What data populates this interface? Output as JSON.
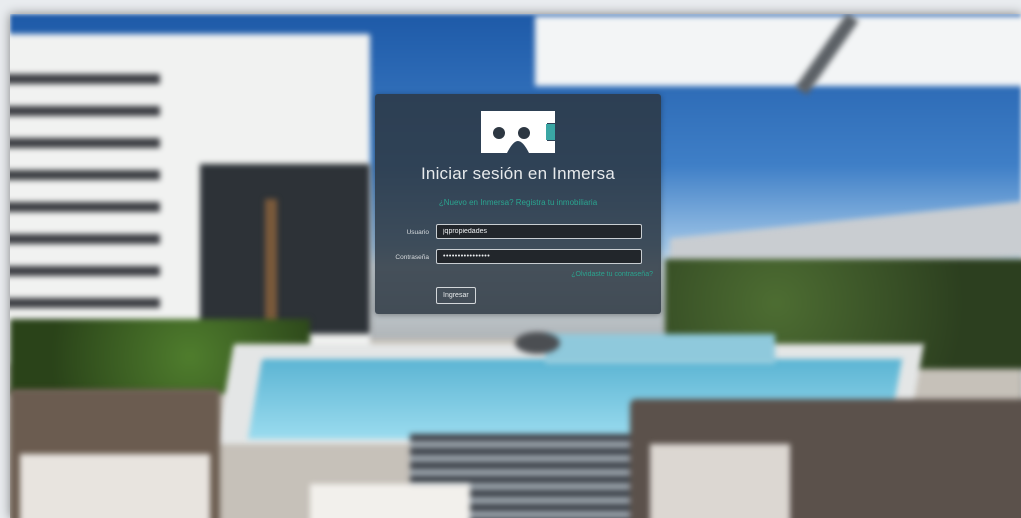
{
  "login": {
    "title": "Iniciar sesión en Inmersa",
    "register_link": "¿Nuevo en Inmersa? Registra tu inmobiliaria",
    "username_label": "Usuario",
    "username_value": "jqpropiedades",
    "password_label": "Contraseña",
    "password_value": "••••••••••••••••",
    "forgot_link": "¿Olvidaste tu contraseña?",
    "submit_label": "Ingresar"
  },
  "logo": {
    "icon": "vr-headset-icon",
    "color": "#ffffff",
    "accent": "#3aa6a4"
  },
  "colors": {
    "link": "#2aa48f",
    "card_bg": "#2d3742"
  }
}
